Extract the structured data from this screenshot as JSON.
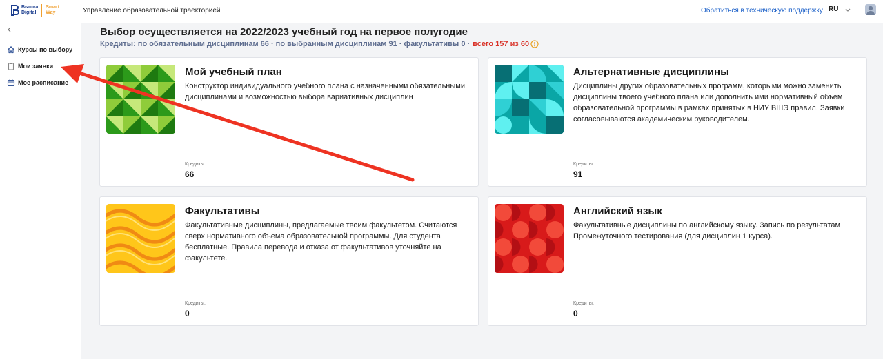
{
  "header": {
    "logo_line1": "Вышка",
    "logo_line2": "Digital",
    "logo_line3": "Smart",
    "logo_line4": "Way",
    "app_title": "Управление образовательной траекторией",
    "support_link": "Обратиться в техническую поддержку",
    "language": "RU"
  },
  "sidebar": {
    "items": [
      {
        "label": "Курсы по выбору",
        "icon": "home-icon"
      },
      {
        "label": "Мои заявки",
        "icon": "clipboard-icon"
      },
      {
        "label": "Мое расписание",
        "icon": "calendar-icon"
      }
    ]
  },
  "main": {
    "heading": "Выбор осуществляется на 2022/2023 учебный год на первое полугодие",
    "credits_summary": "Кредиты: по обязательным дисциплинам 66 · по выбранным дисциплинам 91 · факультативы 0 ·",
    "credits_total": "всего 157 из 60",
    "cards": [
      {
        "title": "Мой учебный план",
        "description": "Конструктор индивидуального учебного плана с назначенными обязательными дисциплинами и возможностью выбора вариативных дисциплин",
        "credits_label": "Кредиты:",
        "credits_value": "66"
      },
      {
        "title": "Альтернативные дисциплины",
        "description": "Дисциплины других образовательных программ, которыми можно заменить дисциплины твоего учебного плана или дополнить ими нормативный объем образовательной программы в рамках принятых в НИУ ВШЭ правил. Заявки согласовываются академическим руководителем.",
        "credits_label": "Кредиты:",
        "credits_value": "91"
      },
      {
        "title": "Факультативы",
        "description": "Факультативные дисциплины, предлагаемые твоим факультетом. Считаются сверх нормативного объема образовательной программы. Для студента бесплатные. Правила перевода и отказа от факультативов уточняйте на факультете.",
        "credits_label": "Кредиты:",
        "credits_value": "0"
      },
      {
        "title": "Английский язык",
        "description": "Факультативные дисциплины по английскому языку. Запись по результатам Промежуточного тестирования (для дисциплин 1 курса).",
        "credits_label": "Кредиты:",
        "credits_value": "0"
      }
    ]
  },
  "colors": {
    "brand": "#1d3f8f",
    "accent_orange": "#f0a030",
    "link": "#1a5fc8",
    "credits_text": "#5e6d8f",
    "over_limit": "#d93228",
    "arrow": "#ee3322"
  }
}
